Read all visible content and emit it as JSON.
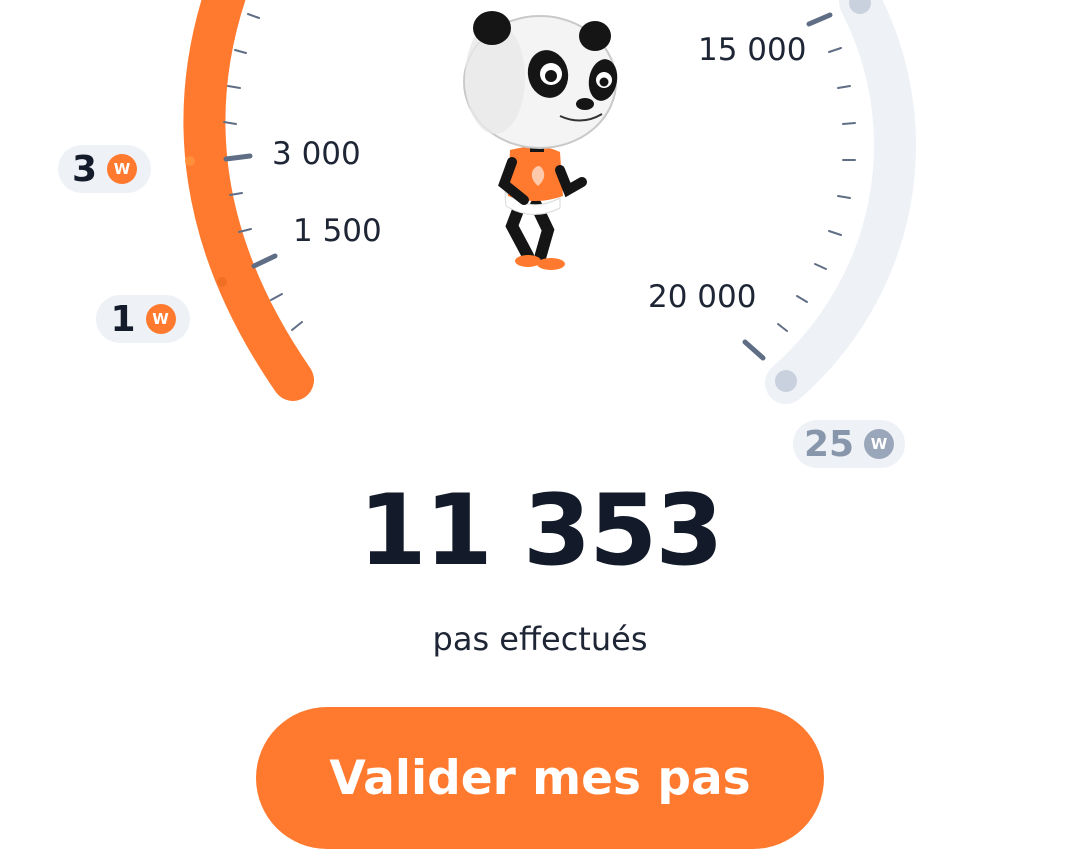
{
  "gauge": {
    "scale_labels": {
      "l1500": "1 500",
      "l3000": "3 000",
      "l15000": "15 000",
      "l20000": "20 000"
    },
    "progress_steps": 11353,
    "progress_color": "#ff7a2f",
    "track_color": "#eef1f6",
    "tick_color": "#5f6e85"
  },
  "rewards": [
    {
      "value": "1",
      "coin": "W"
    },
    {
      "value": "3",
      "coin": "W"
    },
    {
      "value": "25",
      "coin": "W"
    }
  ],
  "mascot": "panda-mascot-running",
  "steps": {
    "count": "11 353",
    "caption": "pas effectués"
  },
  "cta": {
    "label": "Valider mes pas"
  },
  "colors": {
    "accent": "#ff7a2f",
    "text": "#131a29",
    "muted": "#8896ac"
  }
}
